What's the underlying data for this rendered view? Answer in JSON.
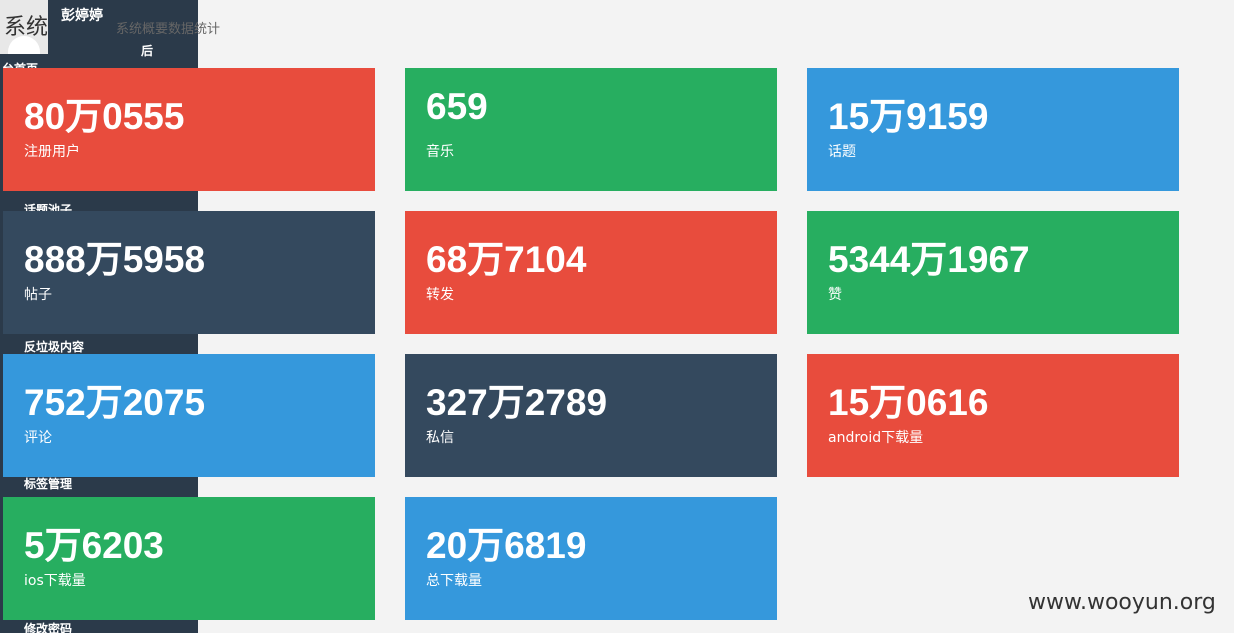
{
  "header": {
    "title": "系统",
    "subtitle": "系统概要数据统计"
  },
  "sidebar": {
    "user": {
      "name": "彭婷婷",
      "suffix": "后"
    },
    "items": [
      {
        "label": "台首页"
      },
      {
        "label": "话题池子"
      },
      {
        "label": "反垃圾内容"
      },
      {
        "label": "标签管理"
      },
      {
        "label": "修改密码"
      }
    ]
  },
  "cards": [
    {
      "value": "80万0555",
      "label": "注册用户",
      "color": "#e84c3d"
    },
    {
      "value": "659",
      "label": "音乐",
      "color": "#27ae60"
    },
    {
      "value": "15万9159",
      "label": "话题",
      "color": "#3598dc"
    },
    {
      "value": "888万5958",
      "label": "帖子",
      "color": "#34495e"
    },
    {
      "value": "68万7104",
      "label": "转发",
      "color": "#e84c3d"
    },
    {
      "value": "5344万1967",
      "label": "赞",
      "color": "#27ae60"
    },
    {
      "value": "752万2075",
      "label": "评论",
      "color": "#3598dc"
    },
    {
      "value": "327万2789",
      "label": "私信",
      "color": "#34495e"
    },
    {
      "value": "15万0616",
      "label": "android下载量",
      "color": "#e84c3d"
    },
    {
      "value": "5万6203",
      "label": "ios下载量",
      "color": "#27ae60"
    },
    {
      "value": "20万6819",
      "label": "总下载量",
      "color": "#3598dc"
    }
  ],
  "watermark": "www.wooyun.org"
}
